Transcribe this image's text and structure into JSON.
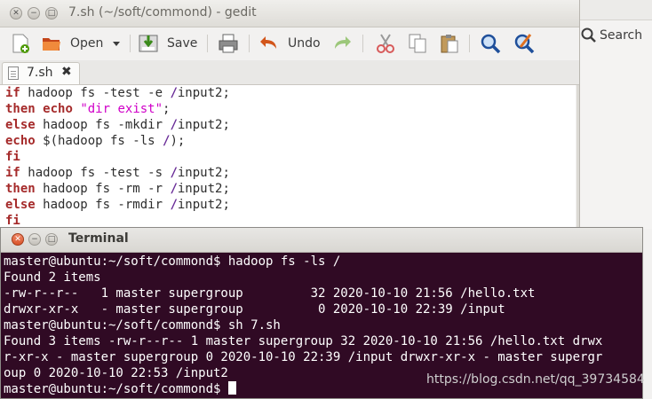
{
  "gedit": {
    "title": "7.sh (~/soft/commond) - gedit",
    "toolbar": {
      "open_label": "Open",
      "save_label": "Save",
      "undo_label": "Undo"
    },
    "tab": {
      "label": "7.sh"
    },
    "code_lines": [
      [
        "if",
        " hadoop fs -test -e ",
        "/",
        "input2;"
      ],
      [
        "then",
        " ",
        "echo",
        " ",
        "\"dir exist\"",
        ";"
      ],
      [
        "else",
        " hadoop fs -mkdir ",
        "/",
        "input2;"
      ],
      [
        "echo",
        " $(hadoop fs -ls ",
        "/",
        ");"
      ],
      [
        "fi"
      ],
      [
        "if",
        " hadoop fs -test -s ",
        "/",
        "input2;"
      ],
      [
        "then",
        " hadoop fs -rm -r ",
        "/",
        "input2;"
      ],
      [
        "else",
        " hadoop fs -rmdir ",
        "/",
        "input2;"
      ],
      [
        "fi"
      ]
    ]
  },
  "background_app": {
    "search_label": "Search"
  },
  "terminal": {
    "title": "Terminal",
    "lines": [
      "master@ubuntu:~/soft/commond$ hadoop fs -ls /",
      "Found 2 items",
      "-rw-r--r--   1 master supergroup         32 2020-10-10 21:56 /hello.txt",
      "drwxr-xr-x   - master supergroup          0 2020-10-10 22:39 /input",
      "master@ubuntu:~/soft/commond$ sh 7.sh",
      "Found 3 items -rw-r--r-- 1 master supergroup 32 2020-10-10 21:56 /hello.txt drwx",
      "r-xr-x - master supergroup 0 2020-10-10 22:39 /input drwxr-xr-x - master supergr",
      "oup 0 2020-10-10 22:53 /input2",
      "master@ubuntu:~/soft/commond$ "
    ]
  },
  "watermark": "https://blog.csdn.net/qq_39734584",
  "colors": {
    "keyword": "#a52a2a",
    "string": "#d000c8",
    "terminal_bg": "#300a24"
  }
}
